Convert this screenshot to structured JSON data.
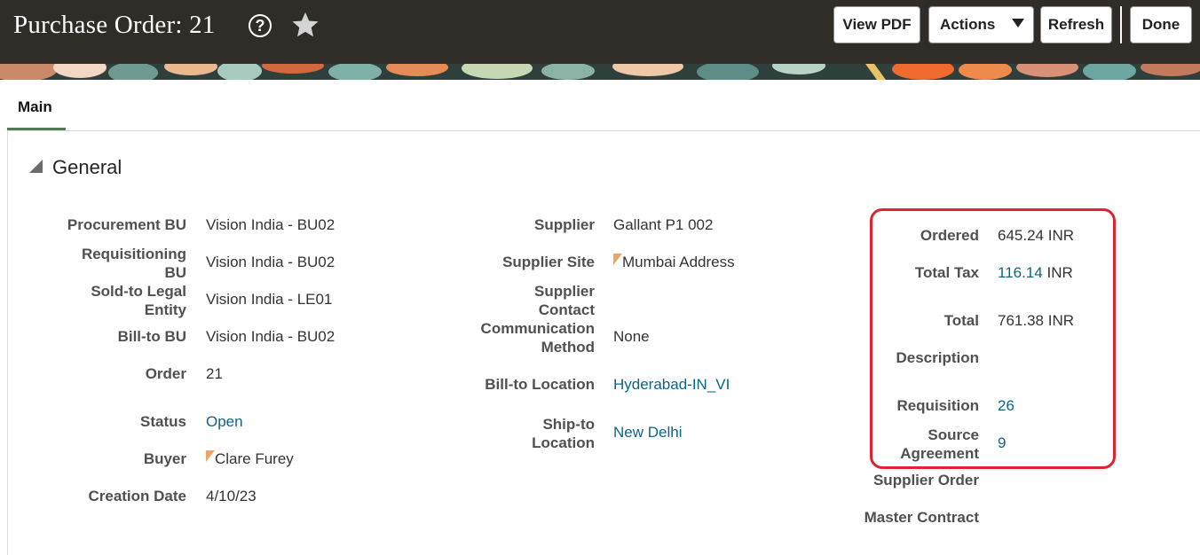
{
  "header": {
    "title": "Purchase Order: 21",
    "help_icon": "?",
    "buttons": {
      "view_pdf": "View PDF",
      "actions": "Actions",
      "refresh": "Refresh",
      "done": "Done"
    }
  },
  "tabs": [
    {
      "label": "Main",
      "selected": true
    }
  ],
  "section": {
    "title": "General",
    "expanded": true
  },
  "column1": {
    "procurement_bu": {
      "label": "Procurement BU",
      "value": "Vision India - BU02"
    },
    "requisitioning_bu": {
      "label_line1": "Requisitioning",
      "label_line2": "BU",
      "value": "Vision India - BU02"
    },
    "sold_to_legal_entity": {
      "label_line1": "Sold-to Legal",
      "label_line2": "Entity",
      "value": "Vision India - LE01"
    },
    "bill_to_bu": {
      "label": "Bill-to BU",
      "value": "Vision India - BU02"
    },
    "order": {
      "label": "Order",
      "value": "21"
    },
    "status": {
      "label": "Status",
      "value": "Open"
    },
    "buyer": {
      "label": "Buyer",
      "value": "Clare Furey"
    },
    "creation_date": {
      "label": "Creation Date",
      "value": "4/10/23"
    }
  },
  "column2": {
    "supplier": {
      "label": "Supplier",
      "value": "Gallant P1 002"
    },
    "supplier_site": {
      "label": "Supplier Site",
      "value": "Mumbai Address"
    },
    "supplier_contact": {
      "label_line1": "Supplier",
      "label_line2": "Contact"
    },
    "communication_method": {
      "label_line1": "Communication",
      "label_line2": "Method",
      "value": "None"
    },
    "bill_to_location": {
      "label": "Bill-to Location",
      "value": "Hyderabad-IN_VI"
    },
    "ship_to_location": {
      "label_line1": "Ship-to",
      "label_line2": "Location",
      "value": "New Delhi"
    }
  },
  "column3": {
    "ordered": {
      "label": "Ordered",
      "value": "645.24",
      "currency": "INR"
    },
    "total_tax": {
      "label": "Total Tax",
      "value": "116.14",
      "currency": "INR"
    },
    "total": {
      "label": "Total",
      "value": "761.38",
      "currency": "INR"
    },
    "description": {
      "label": "Description"
    },
    "requisition": {
      "label": "Requisition",
      "value": "26"
    },
    "source_agreement": {
      "label_line1": "Source",
      "label_line2": "Agreement",
      "value": "9"
    },
    "supplier_order": {
      "label": "Supplier Order"
    },
    "master_contract": {
      "label": "Master Contract"
    }
  },
  "colors": {
    "header_bg": "#302c28",
    "link": "#0b6586",
    "tab_underline": "#4f7a54",
    "highlight": "#e0232f",
    "flag": "#f0a367"
  }
}
